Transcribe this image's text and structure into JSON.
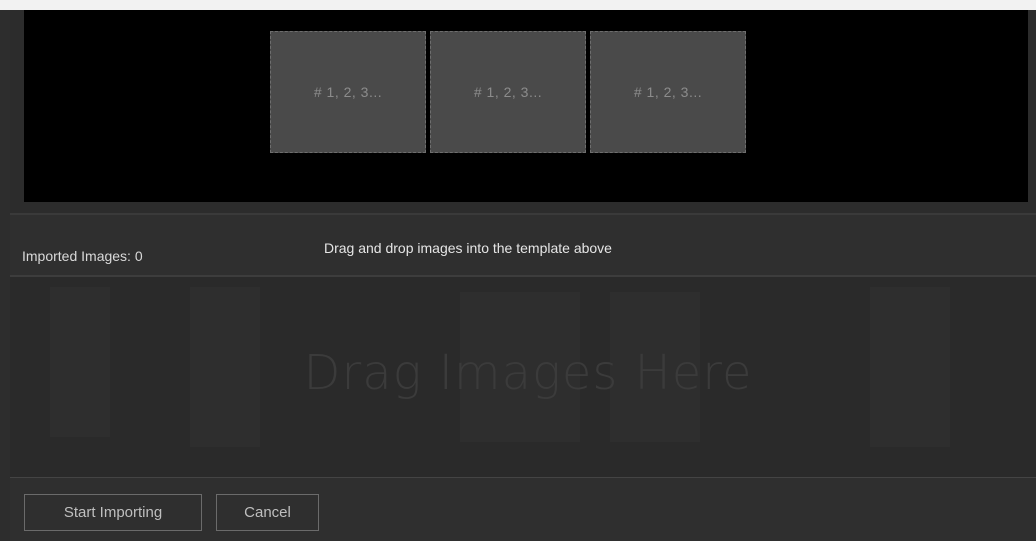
{
  "template": {
    "slots": [
      {
        "label": "# 1, 2, 3..."
      },
      {
        "label": "# 1, 2, 3..."
      },
      {
        "label": "# 1, 2, 3..."
      }
    ]
  },
  "info_bar": {
    "imported_count": "Imported Images: 0",
    "hint": "Drag and drop images into the template above"
  },
  "drop_zone": {
    "placeholder": "Drag Images Here"
  },
  "footer": {
    "start_label": "Start Importing",
    "cancel_label": "Cancel"
  },
  "colors": {
    "background": "#2d2d2d",
    "canvas": "#000000",
    "slot": "#4a4a4a"
  }
}
